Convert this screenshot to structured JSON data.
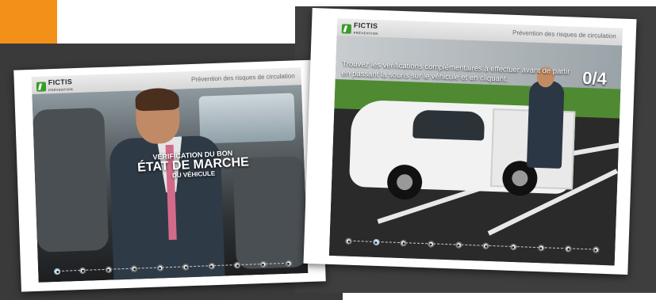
{
  "left_screen": {
    "brand": "FICTIS",
    "brand_sub": "PRÉVENTION",
    "header_title": "Prévention des risques de circulation",
    "headline": {
      "line1": "VÉRIFICATION DU BON",
      "line2": "ÉTAT DE MARCHE",
      "line3": "DU VÉHICULE"
    },
    "progress_steps": 10
  },
  "right_screen": {
    "brand": "FICTIS",
    "brand_sub": "PRÉVENTION",
    "header_title": "Prévention des risques de circulation",
    "instruction": "Trouvez les vérifications complémentaires à effectuer avant de partir en passant la souris sur le véhicule et en cliquant.",
    "counter": "0/4",
    "progress_steps": 10
  },
  "colors": {
    "accent_orange": "#f39018",
    "brand_green": "#3a9b2a"
  }
}
